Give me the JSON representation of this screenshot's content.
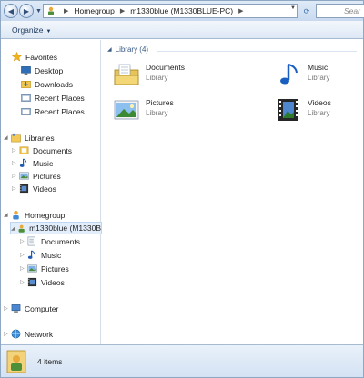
{
  "address_bar": {
    "crumbs": [
      "Homegroup",
      "m1330blue (M1330BLUE-PC)"
    ],
    "search_placeholder": "Sear"
  },
  "toolbar": {
    "organize_label": "Organize"
  },
  "nav": {
    "favorites": {
      "label": "Favorites",
      "items": [
        "Desktop",
        "Downloads",
        "Recent Places",
        "Recent Places"
      ]
    },
    "libraries": {
      "label": "Libraries",
      "items": [
        "Documents",
        "Music",
        "Pictures",
        "Videos"
      ]
    },
    "homegroup": {
      "label": "Homegroup",
      "member": "m1330blue (M1330B",
      "items": [
        "Documents",
        "Music",
        "Pictures",
        "Videos"
      ]
    },
    "computer": "Computer",
    "network": "Network"
  },
  "content": {
    "group_header": "Library (4)",
    "libraries": [
      {
        "name": "Documents",
        "type": "Library",
        "icon": "documents-library-icon"
      },
      {
        "name": "Music",
        "type": "Library",
        "icon": "music-library-icon"
      },
      {
        "name": "Pictures",
        "type": "Library",
        "icon": "pictures-library-icon"
      },
      {
        "name": "Videos",
        "type": "Library",
        "icon": "videos-library-icon"
      }
    ]
  },
  "status": {
    "count_text": "4 items"
  },
  "colors": {
    "accent": "#3b5a85",
    "selection": "#e2eefb",
    "chrome": "#dde8f5"
  }
}
